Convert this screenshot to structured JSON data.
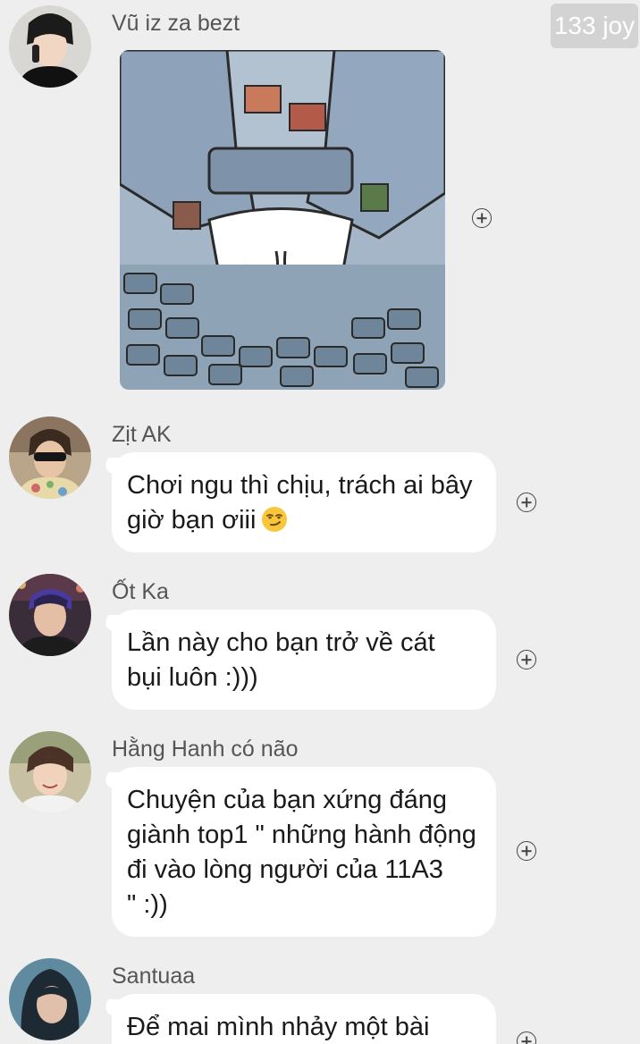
{
  "messages": [
    {
      "sender": "Vũ iz za bezt",
      "type": "sticker",
      "avatar_icon": "person-phone-avatar"
    },
    {
      "sender": "Zịt AK",
      "type": "text",
      "text": "Chơi ngu thì chịu, trách ai bây\ngiờ bạn ơiii",
      "emoji": "smirking-face-emoji",
      "avatar_icon": "person-sunglasses-avatar"
    },
    {
      "sender": "Ốt Ka",
      "type": "text",
      "text": "Lần này cho bạn trở về cát\nbụi luôn :)))",
      "avatar_icon": "person-stage-avatar"
    },
    {
      "sender": "Hằng Hanh có não",
      "type": "text",
      "text": "Chuyện của bạn xứng đáng\ngiành top1 \" những hành động\nđi vào lòng người của 11A3\n\" :))",
      "avatar_icon": "person-smiling-avatar"
    },
    {
      "sender": "Santuaa",
      "type": "text",
      "text": "Để mai mình nhảy một bài",
      "avatar_icon": "person-hood-avatar"
    }
  ],
  "joy_badge": "133 joy",
  "colors": {
    "background": "#eeeeee",
    "bubble": "#ffffff",
    "badge": "#d3d3d3"
  }
}
